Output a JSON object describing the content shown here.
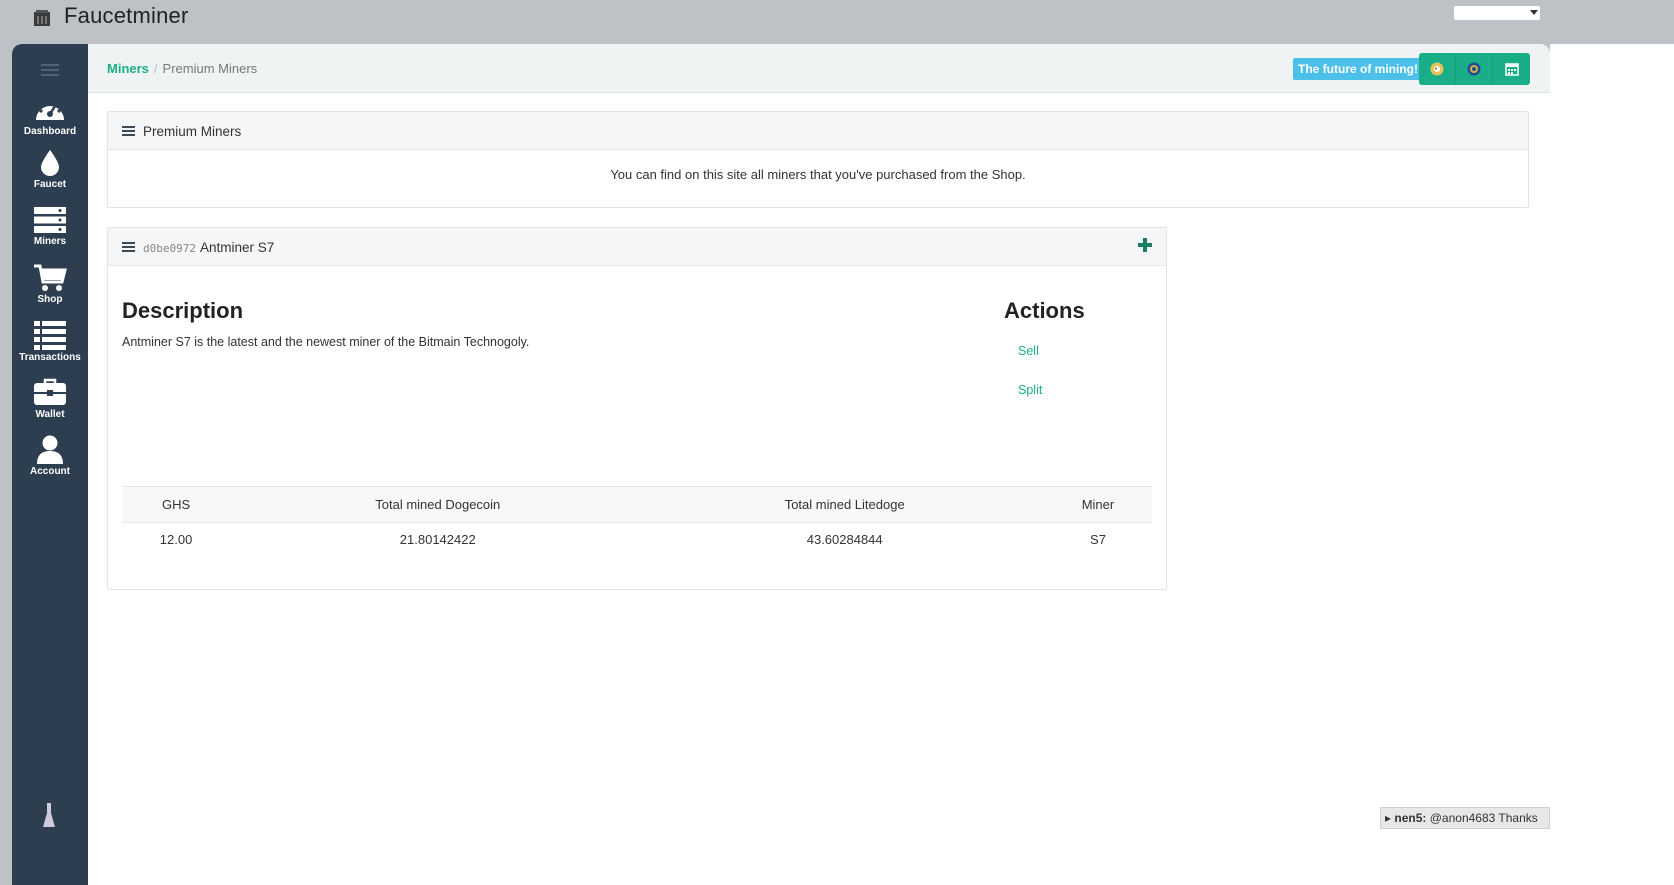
{
  "app": {
    "title": "Faucetminer"
  },
  "sidebar": {
    "items": [
      {
        "label": "Dashboard",
        "icon": "dashboard-icon"
      },
      {
        "label": "Faucet",
        "icon": "drop-icon"
      },
      {
        "label": "Miners",
        "icon": "server-icon"
      },
      {
        "label": "Shop",
        "icon": "cart-icon"
      },
      {
        "label": "Transactions",
        "icon": "list-icon"
      },
      {
        "label": "Wallet",
        "icon": "briefcase-icon"
      },
      {
        "label": "Account",
        "icon": "user-icon"
      }
    ]
  },
  "breadcrumb": {
    "parent": "Miners",
    "separator": "/",
    "current": "Premium Miners"
  },
  "header": {
    "badge": "The future of mining!",
    "buttons": [
      "dogecoin-icon",
      "litedoge-icon",
      "calendar-icon"
    ]
  },
  "intro_panel": {
    "title": "Premium Miners",
    "text": "You can find on this site all miners that you've purchased from the Shop."
  },
  "miner_panel": {
    "code": "d0be0972",
    "name": "Antminer S7",
    "description_title": "Description",
    "description": "Antminer S7 is the latest and the newest miner of the Bitmain Technogoly.",
    "actions_title": "Actions",
    "actions": [
      "Sell",
      "Split"
    ],
    "table": {
      "headers": [
        "GHS",
        "Total mined Dogecoin",
        "Total mined Litedoge",
        "Miner"
      ],
      "row": [
        "12.00",
        "21.80142422",
        "43.60284844",
        "S7"
      ]
    }
  },
  "ticker": {
    "user": "nen5:",
    "message": "@anon4683 Thanks"
  },
  "colors": {
    "accent": "#1aae88",
    "sidebar": "#2c3e50",
    "badge": "#4cc0e8"
  }
}
